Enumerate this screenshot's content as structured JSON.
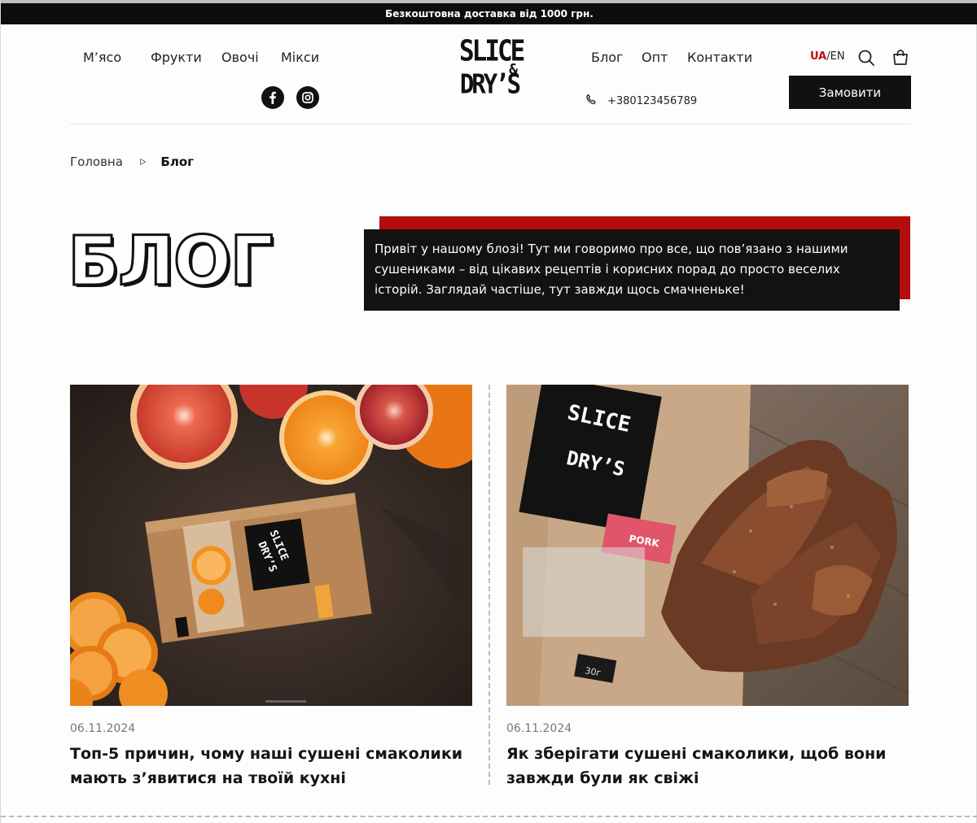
{
  "topbar": {
    "text": "Безкоштовна доставка від 1000 грн."
  },
  "nav_left": [
    {
      "label": "М’ясо"
    },
    {
      "label": "Фрукти"
    },
    {
      "label": "Овочі"
    },
    {
      "label": "Мікси"
    }
  ],
  "nav_right": [
    {
      "label": "Блог"
    },
    {
      "label": "Опт"
    },
    {
      "label": "Контакти"
    }
  ],
  "logo": {
    "line1": "SLICE",
    "amp": "&",
    "line2": "DRY’S"
  },
  "phone": "+380123456789",
  "lang": {
    "active": "UA",
    "sep": "/",
    "other": "EN"
  },
  "order_button": "Замовити",
  "breadcrumb": {
    "home": "Головна",
    "sep": "ᐅ",
    "current": "Блог"
  },
  "page_title": "БЛОГ",
  "intro": "Привіт у нашому блозі! Тут ми говоримо про все, що пов’язано з нашими сушениками – від цікавих рецептів і корисних порад до просто веселих історій. Заглядай частіше, тут завжди щось смачненьке!",
  "posts": [
    {
      "date": "06.11.2024",
      "title": "Топ-5 причин, чому наші сушені смаколики мають з’явитися на твоїй кухні"
    },
    {
      "date": "06.11.2024",
      "title": "Як зберігати сушені смаколики, щоб вони завжди були як свіжі"
    }
  ],
  "package_labels": {
    "brand1": "SLICE",
    "brand2": "DRY’S",
    "pork": "PORK",
    "weight": "30г"
  },
  "colors": {
    "accent_red": "#b30d0d",
    "dark": "#111111",
    "lang_active": "#c10f0f"
  }
}
